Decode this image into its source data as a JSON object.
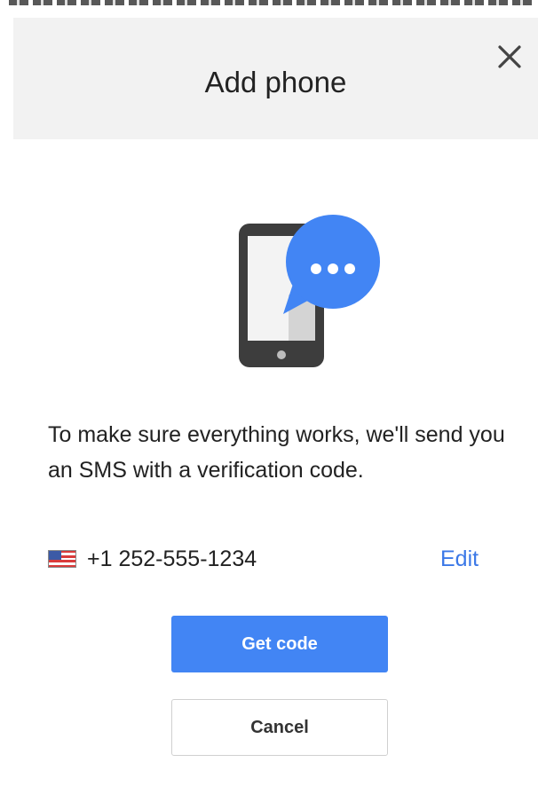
{
  "dialog": {
    "title": "Add phone",
    "message": "To make sure everything works, we'll send you an SMS with a verification code.",
    "phone_number": "+1 252-555-1234",
    "edit_label": "Edit",
    "get_code_label": "Get code",
    "cancel_label": "Cancel"
  },
  "icons": {
    "close": "close-icon",
    "illustration": "phone-chat-bubble-icon",
    "flag": "us-flag-icon"
  },
  "colors": {
    "accent": "#4285f4",
    "link": "#3b78e7",
    "header_bg": "#f2f2f2"
  }
}
